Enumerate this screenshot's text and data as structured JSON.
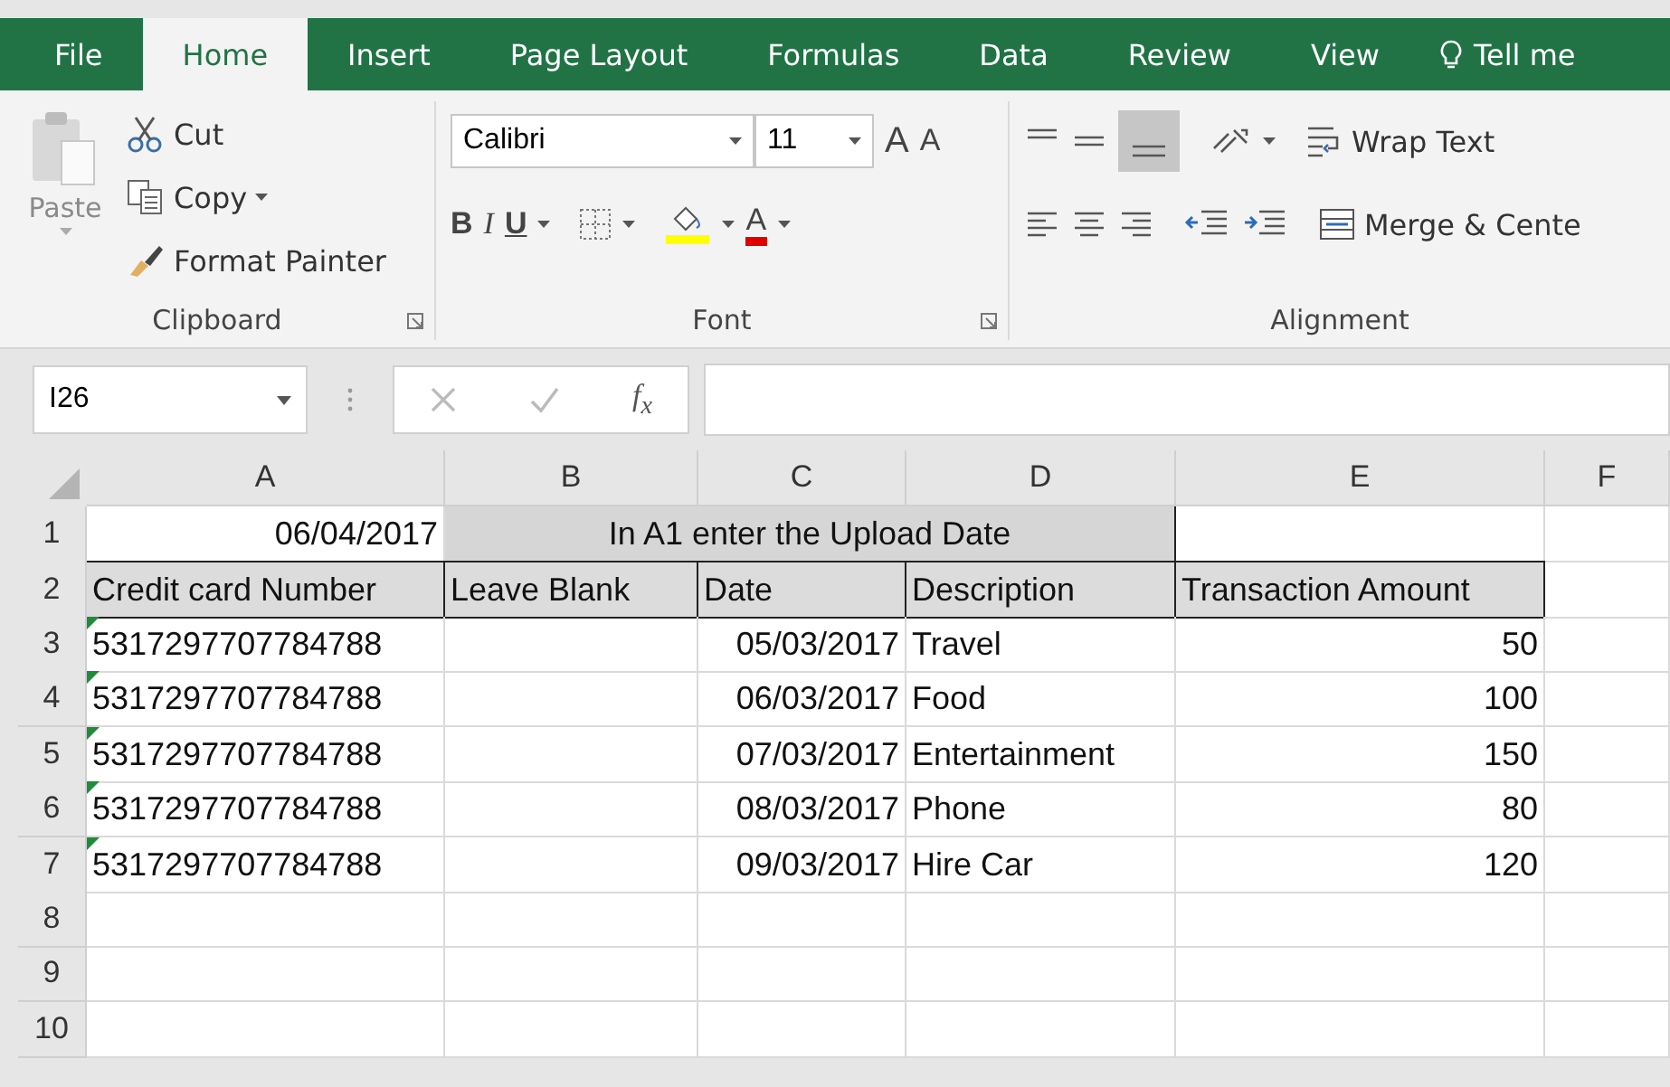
{
  "ribbon_tabs": [
    {
      "label": "File",
      "selected": false
    },
    {
      "label": "Home",
      "selected": true
    },
    {
      "label": "Insert",
      "selected": false
    },
    {
      "label": "Page Layout",
      "selected": false
    },
    {
      "label": "Formulas",
      "selected": false
    },
    {
      "label": "Data",
      "selected": false
    },
    {
      "label": "Review",
      "selected": false
    },
    {
      "label": "View",
      "selected": false
    }
  ],
  "tell_me": "Tell me",
  "clipboard": {
    "paste": "Paste",
    "cut": "Cut",
    "copy": "Copy",
    "format_painter": "Format Painter",
    "label": "Clipboard"
  },
  "font": {
    "name": "Calibri",
    "size": "11",
    "grow": "A",
    "shrink": "A",
    "bold": "B",
    "italic": "I",
    "underline": "U",
    "font_color": "A",
    "label": "Font"
  },
  "alignment": {
    "wrap_text": "Wrap Text",
    "merge": "Merge & Cente",
    "label": "Alignment"
  },
  "name_box": "I26",
  "function_label": "f$_{x}$",
  "sheet": {
    "columns": [
      "A",
      "B",
      "C",
      "D",
      "E",
      "F"
    ],
    "rows": [
      {
        "number": "1",
        "cells": [
          {
            "kind": "date",
            "text": "06/04/2017"
          },
          {
            "kind": "note",
            "text": "In A1 enter the Upload Date"
          },
          {
            "kind": "blank"
          },
          {
            "kind": "blank"
          }
        ]
      },
      {
        "number": "2",
        "cells": [
          {
            "kind": "header",
            "text": "Credit card Number"
          },
          {
            "kind": "header",
            "text": "Leave Blank"
          },
          {
            "kind": "header",
            "text": "Date"
          },
          {
            "kind": "header",
            "text": "Description"
          },
          {
            "kind": "header",
            "text": "Transaction Amount"
          },
          {
            "kind": "blank"
          }
        ]
      },
      {
        "number": "3",
        "cells": [
          {
            "kind": "text",
            "text": "5317297707784788",
            "warning": true
          },
          {
            "kind": "blank"
          },
          {
            "kind": "date",
            "text": "05/03/2017"
          },
          {
            "kind": "text",
            "text": "Travel"
          },
          {
            "kind": "number",
            "text": "50"
          },
          {
            "kind": "blank"
          }
        ]
      },
      {
        "number": "4",
        "cells": [
          {
            "kind": "text",
            "text": "5317297707784788",
            "warning": true
          },
          {
            "kind": "blank"
          },
          {
            "kind": "date",
            "text": "06/03/2017"
          },
          {
            "kind": "text",
            "text": "Food"
          },
          {
            "kind": "number",
            "text": "100"
          },
          {
            "kind": "blank"
          }
        ]
      },
      {
        "number": "5",
        "cells": [
          {
            "kind": "text",
            "text": "5317297707784788",
            "warning": true
          },
          {
            "kind": "blank"
          },
          {
            "kind": "date",
            "text": "07/03/2017"
          },
          {
            "kind": "text",
            "text": "Entertainment"
          },
          {
            "kind": "number",
            "text": "150"
          },
          {
            "kind": "blank"
          }
        ]
      },
      {
        "number": "6",
        "cells": [
          {
            "kind": "text",
            "text": "5317297707784788",
            "warning": true
          },
          {
            "kind": "blank"
          },
          {
            "kind": "date",
            "text": "08/03/2017"
          },
          {
            "kind": "text",
            "text": "Phone"
          },
          {
            "kind": "number",
            "text": "80"
          },
          {
            "kind": "blank"
          }
        ]
      },
      {
        "number": "7",
        "cells": [
          {
            "kind": "text",
            "text": "5317297707784788",
            "warning": true
          },
          {
            "kind": "blank"
          },
          {
            "kind": "date",
            "text": "09/03/2017"
          },
          {
            "kind": "text",
            "text": "Hire Car"
          },
          {
            "kind": "number",
            "text": "120"
          },
          {
            "kind": "blank"
          }
        ]
      },
      {
        "number": "8",
        "cells": [
          {
            "kind": "blank"
          },
          {
            "kind": "blank"
          },
          {
            "kind": "blank"
          },
          {
            "kind": "blank"
          },
          {
            "kind": "blank"
          },
          {
            "kind": "blank"
          }
        ]
      },
      {
        "number": "9",
        "cells": [
          {
            "kind": "blank"
          },
          {
            "kind": "blank"
          },
          {
            "kind": "blank"
          },
          {
            "kind": "blank"
          },
          {
            "kind": "blank"
          },
          {
            "kind": "blank"
          }
        ]
      },
      {
        "number": "10",
        "cells": [
          {
            "kind": "blank"
          },
          {
            "kind": "blank"
          },
          {
            "kind": "blank"
          },
          {
            "kind": "blank"
          },
          {
            "kind": "blank"
          },
          {
            "kind": "blank"
          }
        ]
      }
    ]
  }
}
